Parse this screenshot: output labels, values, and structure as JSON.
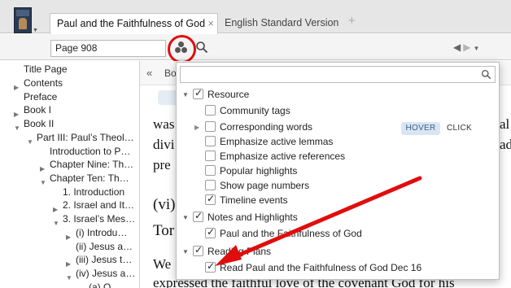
{
  "tabs": [
    {
      "label": "Paul and the Faithfulness of God",
      "close": "×"
    },
    {
      "label": "English Standard Version"
    }
  ],
  "new_tab": "+",
  "toolbar": {
    "reference_value": "Page 908"
  },
  "toc": {
    "items": [
      {
        "label": "Title Page",
        "expander": ""
      },
      {
        "label": "Contents",
        "expander": "▶"
      },
      {
        "label": "Preface",
        "expander": ""
      },
      {
        "label": "Book I",
        "expander": "▶"
      },
      {
        "label": "Book II",
        "expander": "▼"
      },
      {
        "label": "Part III: Paul’s Theol…",
        "expander": "▼"
      },
      {
        "label": "Introduction to P…",
        "expander": ""
      },
      {
        "label": "Chapter Nine: Th…",
        "expander": "▶"
      },
      {
        "label": "Chapter Ten: Th…",
        "expander": "▼"
      },
      {
        "label": "1. Introduction",
        "expander": ""
      },
      {
        "label": "2. Israel and It…",
        "expander": "▶"
      },
      {
        "label": "3. Israel’s Mes…",
        "expander": "▼"
      },
      {
        "label": "(i) Introdu…",
        "expander": "▶"
      },
      {
        "label": "(ii) Jesus a…",
        "expander": ""
      },
      {
        "label": "(iii) Jesus t…",
        "expander": "▶"
      },
      {
        "label": "(iv) Jesus a…",
        "expander": "▼"
      },
      {
        "label": "(a) O…",
        "expander": ""
      }
    ]
  },
  "reader": {
    "breadcrumb_fragment": "Bo",
    "nav_back": "«",
    "left_fragments": [
      "was",
      "divi",
      "pre",
      "(vi)",
      "Tor",
      "We"
    ],
    "right_fragments": [
      "al",
      "ad"
    ],
    "bottom_line": "expressed the faithful love of the covenant God for his"
  },
  "panel": {
    "search_placeholder": "",
    "hover_label": "HOVER",
    "click_label": "CLICK",
    "groups": [
      {
        "label": "Resource",
        "checked": true,
        "items": [
          {
            "label": "Community tags",
            "checked": false
          },
          {
            "label": "Corresponding words",
            "checked": false,
            "expandable": true
          },
          {
            "label": "Emphasize active lemmas",
            "checked": false
          },
          {
            "label": "Emphasize active references",
            "checked": false
          },
          {
            "label": "Popular highlights",
            "checked": false
          },
          {
            "label": "Show page numbers",
            "checked": false
          },
          {
            "label": "Timeline events",
            "checked": true
          }
        ]
      },
      {
        "label": "Notes and Highlights",
        "checked": true,
        "items": [
          {
            "label": "Paul and the Faithfulness of God",
            "checked": true
          }
        ]
      },
      {
        "label": "Reading Plans",
        "checked": true,
        "items": [
          {
            "label": "Read Paul and the Faithfulness of God Dec 16",
            "checked": true
          }
        ]
      }
    ]
  },
  "colors": {
    "annotation_red": "#e10d0d",
    "hover_badge_bg": "#d8e6f4",
    "tab_strip_bg": "#e6e6e6"
  }
}
